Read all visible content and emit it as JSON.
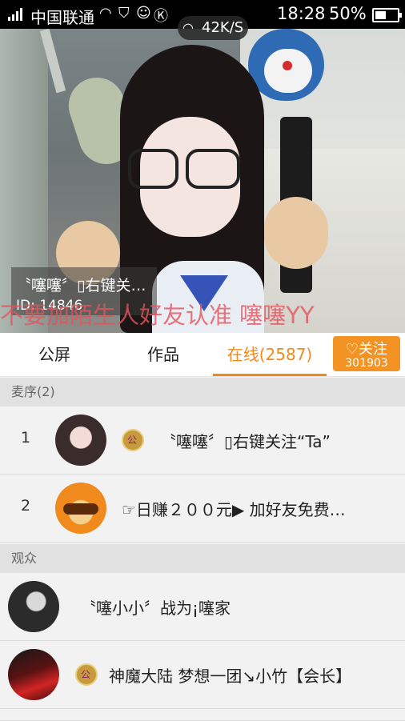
{
  "status_bar": {
    "carrier": "中国联通",
    "time": "18:28",
    "battery_percent": "50%",
    "battery_level": 0.5
  },
  "video": {
    "net_speed": "42K/S",
    "host_name": "〝噻噻〞▯右键关…",
    "host_id": "ID: 14846",
    "marquee_text": "不要加陌生人好友认准 噻噻YY"
  },
  "tabs": [
    {
      "label": "公屏",
      "active": false
    },
    {
      "label": "作品",
      "active": false
    },
    {
      "label": "在线(2587)",
      "active": true
    }
  ],
  "follow": {
    "label": "♡关注",
    "count": "301903"
  },
  "mic_queue": {
    "header": "麦序(2)",
    "items": [
      {
        "rank": "1",
        "name": "〝噻噻〞▯右键关注“Ta”",
        "has_badge": true
      },
      {
        "rank": "2",
        "name": "☞日赚２００元▶ 加好友免费…",
        "has_badge": false
      }
    ]
  },
  "audience": {
    "header": "观众",
    "items": [
      {
        "name": "〝噻小小〞战为¡噻家",
        "has_badge": false
      },
      {
        "name": "神魔大陆 梦想一团↘小竹【会长】",
        "has_badge": true
      }
    ]
  },
  "colors": {
    "accent": "#f08a1d",
    "follow_bg": "#f39323",
    "marquee": "#e5545d"
  }
}
